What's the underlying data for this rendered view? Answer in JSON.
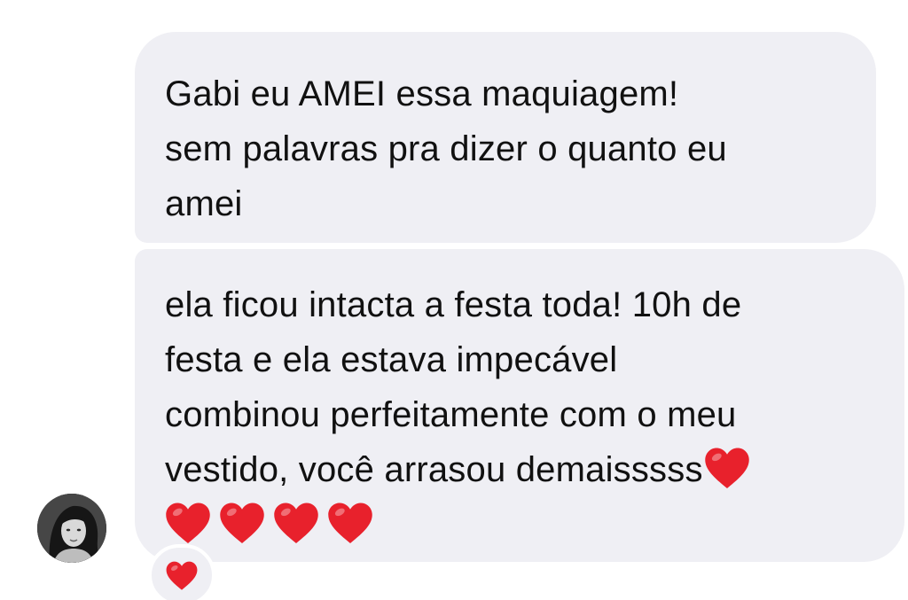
{
  "conversation": {
    "messages": [
      {
        "lines": [
          "Gabi eu AMEI essa maquiagem!",
          "sem palavras pra dizer o quanto eu",
          "amei"
        ]
      },
      {
        "lines": [
          "ela ficou intacta a festa toda! 10h de",
          "festa e ela estava impecável",
          "combinou perfeitamente com o meu",
          "vestido, você arrasou demaisssss"
        ],
        "trailing_emoji": "heart-emoji",
        "emoji_row_count": 4
      }
    ],
    "reaction": {
      "icon": "heart-emoji"
    }
  },
  "colors": {
    "bubble": "#efeff4",
    "text": "#111111",
    "heart": "#e8212c"
  }
}
